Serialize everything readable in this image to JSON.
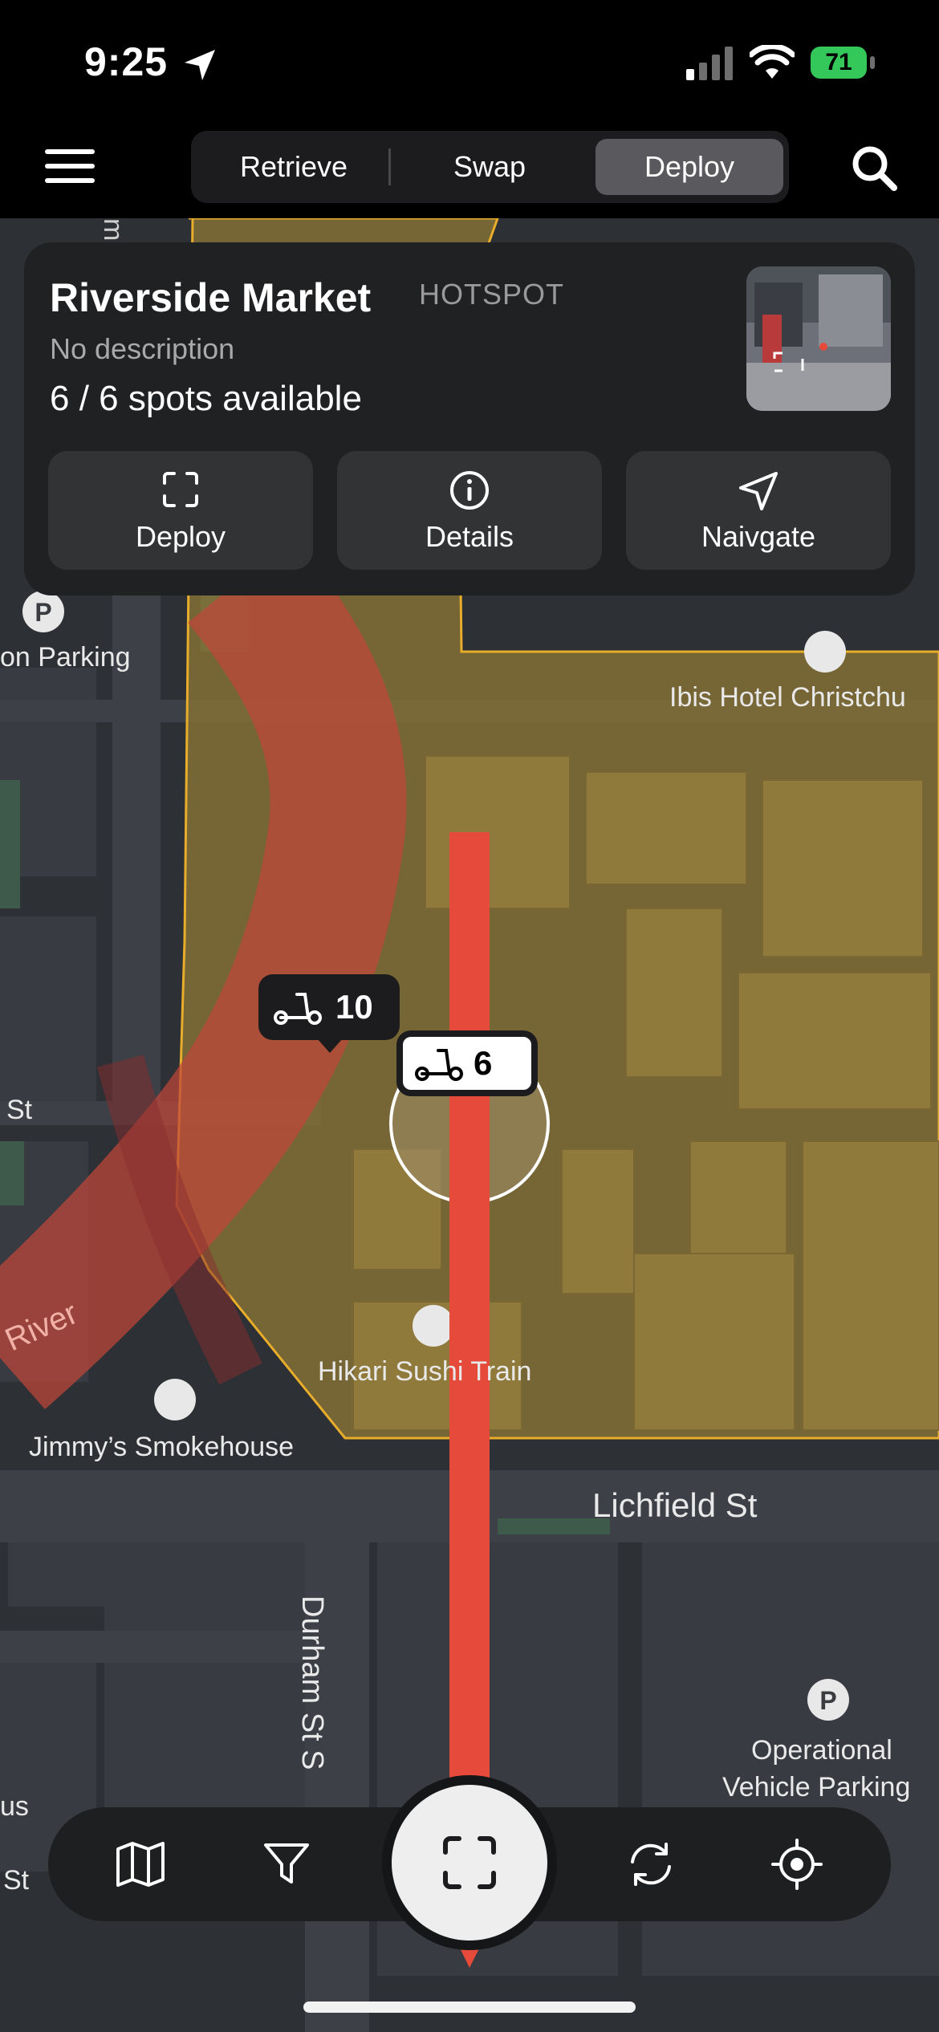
{
  "status": {
    "time": "9:25",
    "battery": "71"
  },
  "tabs": [
    {
      "label": "Retrieve",
      "active": false
    },
    {
      "label": "Swap",
      "active": false
    },
    {
      "label": "Deploy",
      "active": true
    }
  ],
  "card": {
    "title": "Riverside Market",
    "tag": "HOTSPOT",
    "description": "No description",
    "spots": "6 / 6 spots available",
    "buttons": [
      {
        "label": "Deploy",
        "icon": "scan-icon"
      },
      {
        "label": "Details",
        "icon": "info-icon"
      },
      {
        "label": "Naivgate",
        "icon": "navigate-arrow-icon"
      }
    ]
  },
  "map": {
    "labels": {
      "parking_left": "on Parking",
      "ibis": "Ibis Hotel Christchu",
      "st_left": "St",
      "river": "River",
      "jimmys": "Jimmy’s Smokehouse",
      "hikari": "Hikari Sushi Train",
      "lichfield": "Lichfield St",
      "durham": "Durham St S",
      "operational_1": "Operational",
      "operational_2": "Vehicle Parking",
      "us": "us",
      "st_bottom": "St",
      "m_top": "m"
    },
    "pins": [
      {
        "count": "10"
      },
      {
        "count": "6"
      }
    ]
  },
  "bottom_nav": [
    {
      "name": "map-icon"
    },
    {
      "name": "filter-icon"
    },
    {
      "name": "scan-icon"
    },
    {
      "name": "swap-icon"
    },
    {
      "name": "locate-icon"
    }
  ],
  "colors": {
    "hotspot": "#e8ad2a",
    "arrow": "#e64a3b",
    "river": "#c9473b",
    "active_tab": "#5a5a5e"
  }
}
